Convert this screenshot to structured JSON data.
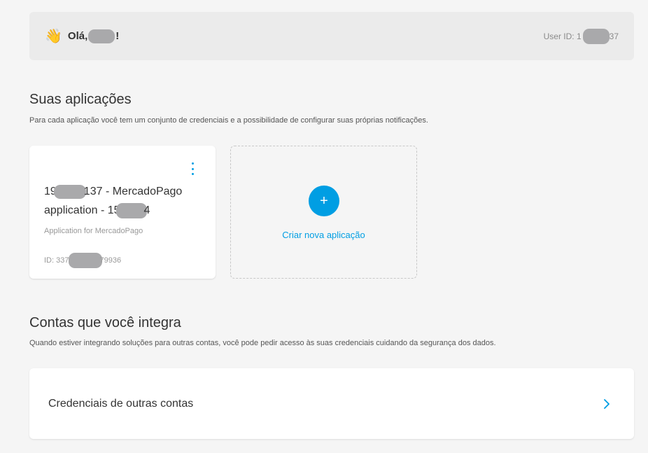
{
  "greeting": {
    "icon": "waving-hand-icon",
    "emoji": "👋",
    "hello_prefix": "Olá,",
    "hello_suffix": "!",
    "user_id_prefix": "User ID: 1",
    "user_id_suffix": "37"
  },
  "apps_section": {
    "title": "Suas aplicações",
    "subtitle": "Para cada aplicação você tem um conjunto de credenciais e a possibilidade de configurar suas próprias notificações."
  },
  "app_card": {
    "name_line1_prefix": "19",
    "name_line1_suffix": "137 - MercadoPago",
    "name_line2_prefix": "application - 15",
    "name_line2_suffix": "4",
    "description": "Application for MercadoPago",
    "id_prefix": "ID: 337",
    "id_suffix": "79936",
    "menu_icon": "kebab-menu-icon"
  },
  "create_card": {
    "icon": "plus-icon",
    "plus_glyph": "+",
    "label": "Criar nova aplicação"
  },
  "integrations_section": {
    "title": "Contas que você integra",
    "subtitle": "Quando estiver integrando soluções para outras contas, você pode pedir acesso às suas credenciais cuidando da segurança dos dados."
  },
  "credentials_card": {
    "label": "Credenciais de outras contas",
    "icon": "chevron-right-icon"
  },
  "colors": {
    "accent": "#009ee3",
    "background": "#f5f5f5",
    "greeting_bg": "#ebebeb",
    "redaction": "#a9a9ab"
  }
}
